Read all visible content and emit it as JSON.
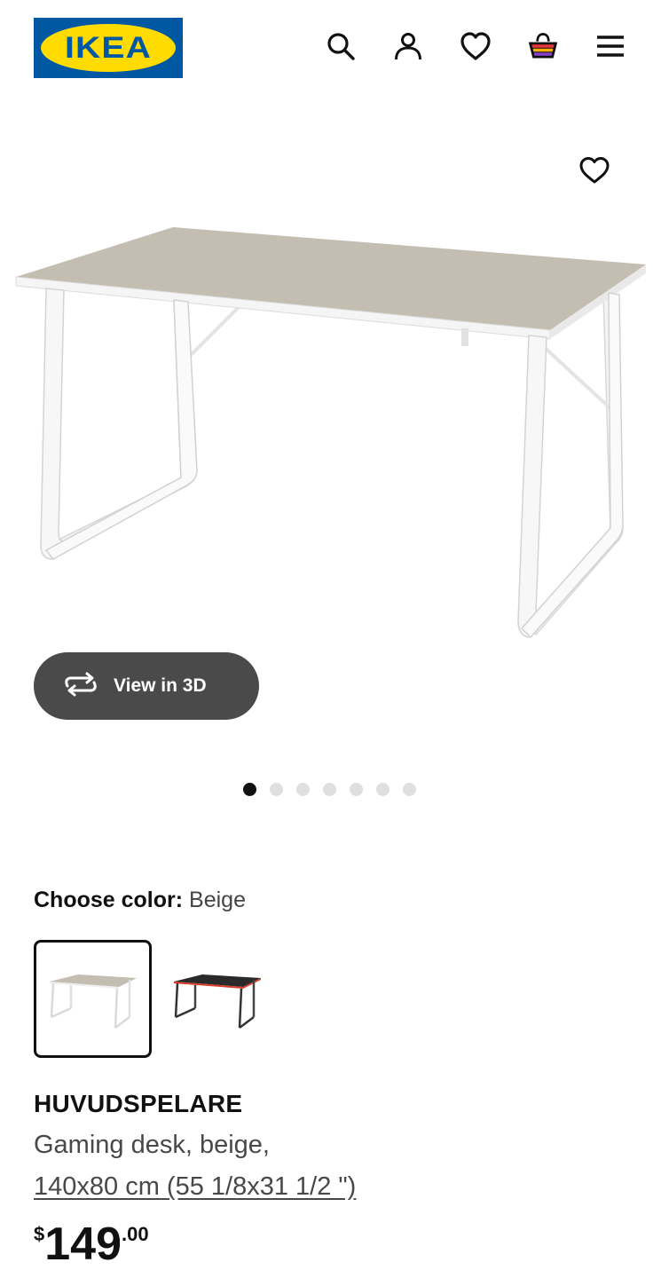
{
  "header": {
    "logo_text": "IKEA",
    "logo_reg": "®",
    "icons": [
      "search-icon",
      "account-icon",
      "favorites-icon",
      "shopping-bag-icon",
      "menu-icon"
    ],
    "brand_blue": "#0058a3",
    "brand_yellow": "#ffdb00"
  },
  "gallery": {
    "view_3d_label": "View in 3D",
    "image_count": 7,
    "active_index": 0
  },
  "color_choice": {
    "label": "Choose color:",
    "selected": "Beige",
    "options": [
      "Beige",
      "Black/red"
    ]
  },
  "product": {
    "name": "HUVUDSPELARE",
    "description": "Gaming desk, beige,",
    "dimensions": "140x80 cm (55 1/8x31 1/2 \")",
    "price_currency": "$",
    "price_integer": "149",
    "price_decimal": ".00"
  }
}
